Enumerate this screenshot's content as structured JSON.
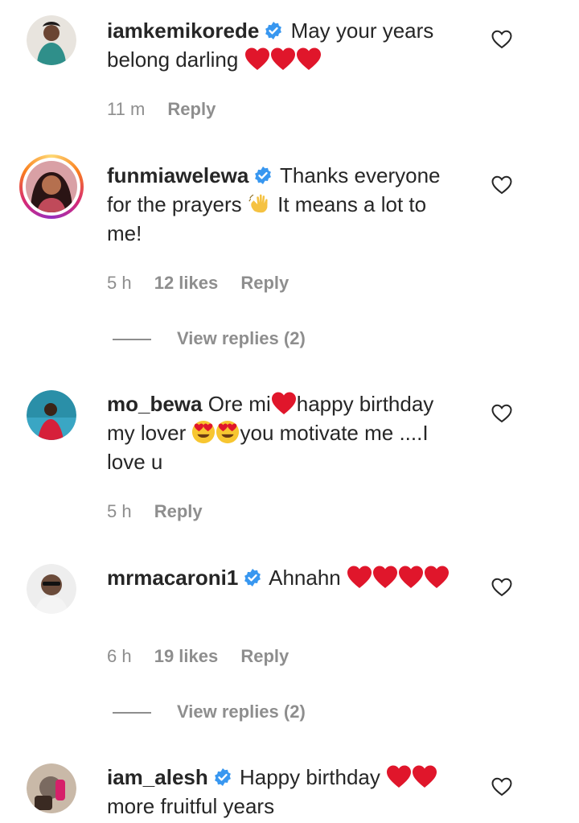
{
  "comments": [
    {
      "username": "iamkemikorede",
      "verified": true,
      "text_parts": [
        "May your years belong darling"
      ],
      "time": "11 m",
      "likes": "",
      "reply_label": "Reply",
      "avatar_color": "#2f8f8a"
    },
    {
      "username": "funmiawelewa",
      "verified": true,
      "text_parts": [
        "Thanks everyone for the prayers",
        "It means a lot to me!"
      ],
      "time": "5 h",
      "likes": "12 likes",
      "reply_label": "Reply",
      "view_replies": "View replies (2)",
      "avatar_color": "#c04a5a"
    },
    {
      "username": "mo_bewa",
      "verified": false,
      "text_parts": [
        "Ore mi",
        "happy birthday my lover",
        "you motivate me ....I love u"
      ],
      "time": "5 h",
      "likes": "",
      "reply_label": "Reply",
      "avatar_color": "#2a8fa8"
    },
    {
      "username": "mrmacaroni1",
      "verified": true,
      "text_parts": [
        "Ahnahn"
      ],
      "time": "6 h",
      "likes": "19 likes",
      "reply_label": "Reply",
      "view_replies": "View replies (2)",
      "avatar_color": "#6b4b3a"
    },
    {
      "username": "iam_alesh",
      "verified": true,
      "text_parts": [
        "Happy birthday",
        "more fruitful years"
      ],
      "time": "",
      "likes": "",
      "reply_label": "",
      "avatar_color": "#7a6a60"
    }
  ],
  "colors": {
    "verified_blue": "#3897f0",
    "heart_red": "#e0162b",
    "meta_gray": "#8e8e8e"
  },
  "icons": {
    "verified": "verified-badge-icon",
    "like": "heart-outline-icon",
    "heart": "red-heart-emoji",
    "wave": "waving-hand-emoji",
    "heart_eyes": "heart-eyes-emoji"
  }
}
